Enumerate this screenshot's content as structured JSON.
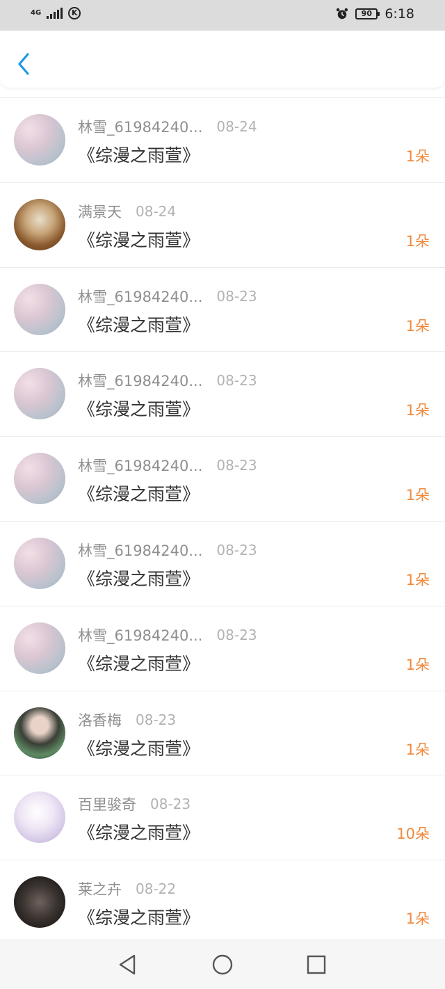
{
  "status_bar": {
    "network": "4G",
    "carrier_icon": "K",
    "battery": "90",
    "time": "6:18"
  },
  "header": {
    "back_icon": "chevron-left-icon"
  },
  "colors": {
    "accent": "#f08a3c",
    "back": "#1a9be6",
    "name": "#8f8f8f",
    "date": "#b2b2b2"
  },
  "items": [
    {
      "name": "林雪_61984240...",
      "date": "08-24",
      "title": "《综漫之雨萱》",
      "count": "1朵",
      "avatar": "pastel-blanket"
    },
    {
      "name": "满景天",
      "date": "08-24",
      "title": "《综漫之雨萱》",
      "count": "1朵",
      "avatar": "kitten-basket"
    },
    {
      "name": "林雪_61984240...",
      "date": "08-23",
      "title": "《综漫之雨萱》",
      "count": "1朵",
      "avatar": "pastel-blanket"
    },
    {
      "name": "林雪_61984240...",
      "date": "08-23",
      "title": "《综漫之雨萱》",
      "count": "1朵",
      "avatar": "pastel-blanket"
    },
    {
      "name": "林雪_61984240...",
      "date": "08-23",
      "title": "《综漫之雨萱》",
      "count": "1朵",
      "avatar": "pastel-blanket"
    },
    {
      "name": "林雪_61984240...",
      "date": "08-23",
      "title": "《综漫之雨萱》",
      "count": "1朵",
      "avatar": "pastel-blanket"
    },
    {
      "name": "林雪_61984240...",
      "date": "08-23",
      "title": "《综漫之雨萱》",
      "count": "1朵",
      "avatar": "pastel-blanket"
    },
    {
      "name": "洛香梅",
      "date": "08-23",
      "title": "《综漫之雨萱》",
      "count": "1朵",
      "avatar": "dark-hair-girl"
    },
    {
      "name": "百里骏奇",
      "date": "08-23",
      "title": "《综漫之雨萱》",
      "count": "10朵",
      "avatar": "anime-white-hair"
    },
    {
      "name": "莱之卉",
      "date": "08-22",
      "title": "《综漫之雨萱》",
      "count": "1朵",
      "avatar": "dark-figure"
    }
  ],
  "nav": {
    "back": "nav-back-icon",
    "home": "nav-home-icon",
    "recents": "nav-recents-icon"
  }
}
